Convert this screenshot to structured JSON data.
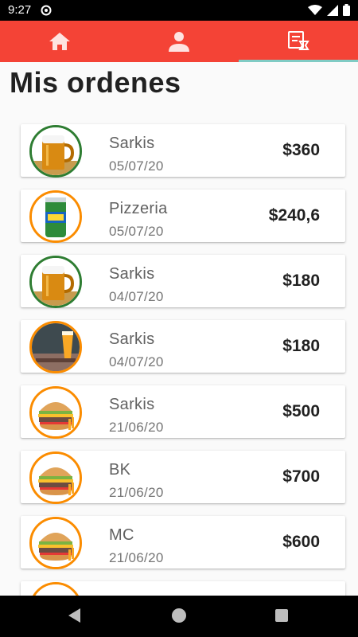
{
  "status_bar": {
    "time": "9:27",
    "icons": [
      "wifi-icon",
      "signal-icon",
      "battery-icon"
    ]
  },
  "tabs": [
    {
      "icon": "home-icon",
      "active": false
    },
    {
      "icon": "person-icon",
      "active": false
    },
    {
      "icon": "order-history-icon",
      "active": true
    }
  ],
  "page": {
    "title": "Mis ordenes"
  },
  "orders": [
    {
      "name": "Sarkis",
      "date": "05/07/20",
      "price": "$360",
      "image": "beer",
      "ring": "green"
    },
    {
      "name": "Pizzeria",
      "date": "05/07/20",
      "price": "$240,6",
      "image": "sprite-can",
      "ring": "orange"
    },
    {
      "name": "Sarkis",
      "date": "04/07/20",
      "price": "$180",
      "image": "beer",
      "ring": "green"
    },
    {
      "name": "Sarkis",
      "date": "04/07/20",
      "price": "$180",
      "image": "beer-glass",
      "ring": "orange"
    },
    {
      "name": "Sarkis",
      "date": "21/06/20",
      "price": "$500",
      "image": "burger",
      "ring": "orange"
    },
    {
      "name": "BK",
      "date": "21/06/20",
      "price": "$700",
      "image": "burger",
      "ring": "orange"
    },
    {
      "name": "MC",
      "date": "21/06/20",
      "price": "$600",
      "image": "burger",
      "ring": "orange"
    },
    {
      "name": "",
      "date": "",
      "price": "",
      "image": "burger",
      "ring": "orange"
    }
  ],
  "colors": {
    "accent": "#f44336",
    "tab_indicator": "#80cbc4",
    "ring_green": "#2e7d32",
    "ring_orange": "#fb8c00"
  }
}
